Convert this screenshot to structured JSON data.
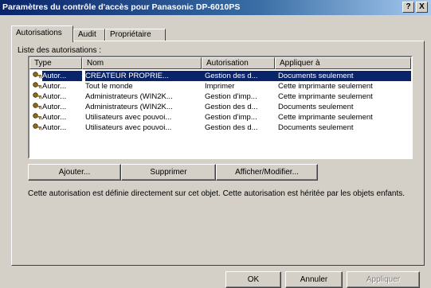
{
  "window": {
    "title": "Paramètres du contrôle d'accès pour Panasonic DP-6010PS",
    "help_label": "?",
    "close_label": "X"
  },
  "tabs": [
    {
      "label": "Autorisations"
    },
    {
      "label": "Audit"
    },
    {
      "label": "Propriétaire"
    }
  ],
  "list": {
    "label": "Liste des autorisations :",
    "columns": [
      "Type",
      "Nom",
      "Autorisation",
      "Appliquer à"
    ],
    "rows": [
      {
        "type": "Autor...",
        "name": "CREATEUR PROPRIE...",
        "permission": "Gestion des d...",
        "apply": "Documents seulement"
      },
      {
        "type": "Autor...",
        "name": "Tout le monde",
        "permission": "Imprimer",
        "apply": "Cette imprimante seulement"
      },
      {
        "type": "Autor...",
        "name": "Administrateurs (WIN2K...",
        "permission": "Gestion d'imp...",
        "apply": "Cette imprimante seulement"
      },
      {
        "type": "Autor...",
        "name": "Administrateurs (WIN2K...",
        "permission": "Gestion des d...",
        "apply": "Documents seulement"
      },
      {
        "type": "Autor...",
        "name": "Utilisateurs avec pouvoi...",
        "permission": "Gestion d'imp...",
        "apply": "Cette imprimante seulement"
      },
      {
        "type": "Autor...",
        "name": "Utilisateurs avec pouvoi...",
        "permission": "Gestion des d...",
        "apply": "Documents seulement"
      }
    ]
  },
  "actions": {
    "add": "Ajouter...",
    "remove": "Supprimer",
    "view_edit": "Afficher/Modifier..."
  },
  "description": "Cette autorisation est définie directement sur cet objet. Cette autorisation est héritée par les objets enfants.",
  "footer": {
    "ok": "OK",
    "cancel": "Annuler",
    "apply": "Appliquer"
  }
}
